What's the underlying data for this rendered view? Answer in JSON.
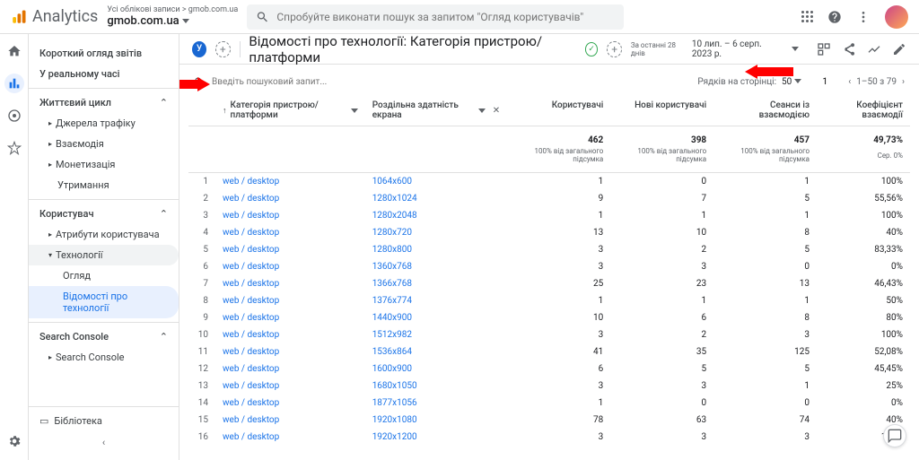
{
  "top": {
    "product": "Analytics",
    "crumb": "Усі облікові записи > gmob.com.ua",
    "property": "gmob.com.ua",
    "search_ph": "Спробуйте виконати пошук за запитом \"Огляд користувачів\""
  },
  "sidebar": {
    "s1_title": "Короткий огляд звітів",
    "s2_title": "У реальному часі",
    "g1": "Життєвий цикл",
    "g1_items": [
      "Джерела трафіку",
      "Взаємодія",
      "Монетизація",
      "Утримання"
    ],
    "g2": "Користувач",
    "g2_items": [
      "Атрибути користувача",
      "Технології"
    ],
    "g2_sub": [
      "Огляд",
      "Відомості про технології"
    ],
    "g3": "Search Console",
    "g3_items": [
      "Search Console"
    ],
    "lib": "Бібліотека"
  },
  "report": {
    "title": "Відомості про технології: Категорія пристрою/платформи",
    "date_lbl": "За останні 28 днів",
    "date_range": "10 лип. – 6 серп. 2023 р.",
    "search_ph": "Введіть пошуковий запит...",
    "rows_lbl": "Рядків на сторінці:",
    "rows_val": "50",
    "goto_val": "1",
    "range_info": "1–50 з 79"
  },
  "columns": {
    "dim1": "Категорія пристрою/платформи",
    "dim2": "Роздільна здатність екрана",
    "m1": "Користувачі",
    "m2": "Нові користувачі",
    "m3": "Сеанси із взаємодією",
    "m4": "Коефіцієнт взаємодії"
  },
  "totals": {
    "m1": "462",
    "m2": "398",
    "m3": "457",
    "m4": "49,73%",
    "sub": "100% від загального підсумка",
    "sub4": "Сер. 0%"
  },
  "rows": [
    {
      "i": 1,
      "d": "web / desktop",
      "r": "1064x600",
      "m1": "1",
      "m2": "0",
      "m3": "1",
      "m4": "100%"
    },
    {
      "i": 2,
      "d": "web / desktop",
      "r": "1280x1024",
      "m1": "9",
      "m2": "7",
      "m3": "5",
      "m4": "55,56%"
    },
    {
      "i": 3,
      "d": "web / desktop",
      "r": "1280x2048",
      "m1": "1",
      "m2": "1",
      "m3": "1",
      "m4": "100%"
    },
    {
      "i": 4,
      "d": "web / desktop",
      "r": "1280x720",
      "m1": "13",
      "m2": "10",
      "m3": "8",
      "m4": "40%"
    },
    {
      "i": 5,
      "d": "web / desktop",
      "r": "1280x800",
      "m1": "3",
      "m2": "2",
      "m3": "5",
      "m4": "83,33%"
    },
    {
      "i": 6,
      "d": "web / desktop",
      "r": "1360x768",
      "m1": "3",
      "m2": "3",
      "m3": "0",
      "m4": "0%"
    },
    {
      "i": 7,
      "d": "web / desktop",
      "r": "1366x768",
      "m1": "25",
      "m2": "23",
      "m3": "13",
      "m4": "46,43%"
    },
    {
      "i": 8,
      "d": "web / desktop",
      "r": "1376x774",
      "m1": "1",
      "m2": "1",
      "m3": "1",
      "m4": "50%"
    },
    {
      "i": 9,
      "d": "web / desktop",
      "r": "1440x900",
      "m1": "10",
      "m2": "6",
      "m3": "8",
      "m4": "80%"
    },
    {
      "i": 10,
      "d": "web / desktop",
      "r": "1512x982",
      "m1": "3",
      "m2": "2",
      "m3": "3",
      "m4": "100%"
    },
    {
      "i": 11,
      "d": "web / desktop",
      "r": "1536x864",
      "m1": "41",
      "m2": "35",
      "m3": "125",
      "m4": "52,08%"
    },
    {
      "i": 12,
      "d": "web / desktop",
      "r": "1600x900",
      "m1": "6",
      "m2": "5",
      "m3": "5",
      "m4": "45,45%"
    },
    {
      "i": 13,
      "d": "web / desktop",
      "r": "1680x1050",
      "m1": "3",
      "m2": "3",
      "m3": "1",
      "m4": "25%"
    },
    {
      "i": 14,
      "d": "web / desktop",
      "r": "1877x1056",
      "m1": "1",
      "m2": "0",
      "m3": "0",
      "m4": "0%"
    },
    {
      "i": 15,
      "d": "web / desktop",
      "r": "1920x1080",
      "m1": "78",
      "m2": "63",
      "m3": "74",
      "m4": "40%"
    },
    {
      "i": 16,
      "d": "web / desktop",
      "r": "1920x1200",
      "m1": "3",
      "m2": "3",
      "m3": "3",
      "m4": "100%"
    }
  ]
}
